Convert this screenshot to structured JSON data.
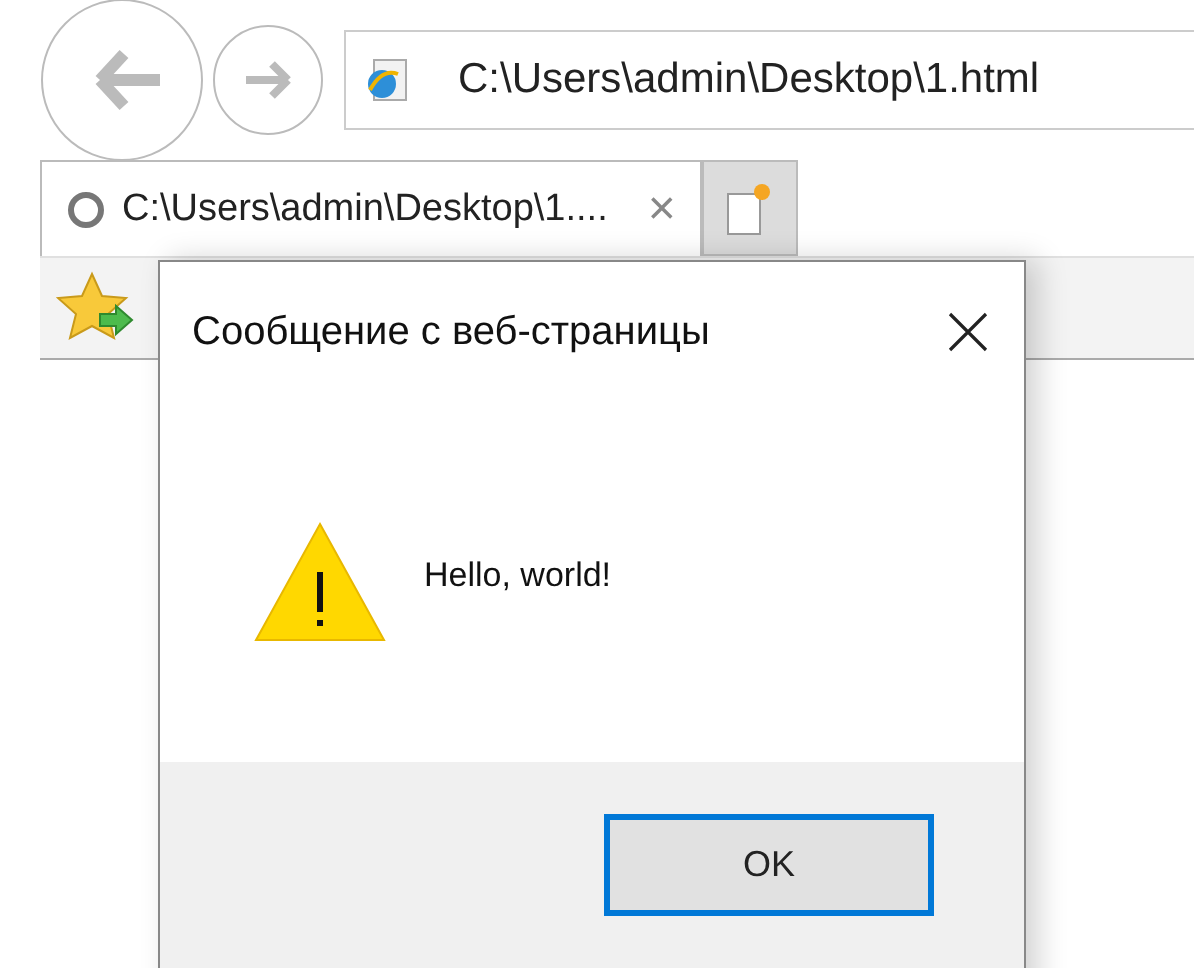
{
  "address_bar": {
    "value": "C:\\Users\\admin\\Desktop\\1.html"
  },
  "tabs": [
    {
      "title": "C:\\Users\\admin\\Desktop\\1....",
      "selected": true,
      "close": "×"
    }
  ],
  "dialog": {
    "title": "Сообщение с веб-страницы",
    "message": "Hello, world!",
    "buttons": [
      {
        "label": "OK",
        "focused": true
      }
    ]
  }
}
